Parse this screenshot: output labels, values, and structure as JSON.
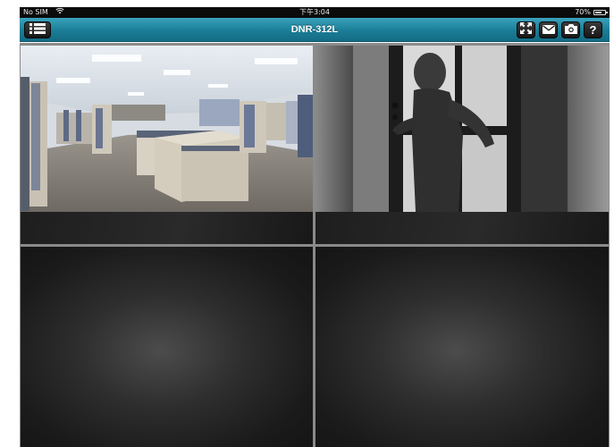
{
  "status_bar": {
    "carrier": "No SIM",
    "wifi_icon": "wifi-icon",
    "time": "下午3:04",
    "battery_percent": "70%",
    "battery_level": 0.7
  },
  "nav_bar": {
    "title": "DNR-312L",
    "background_color": "#1f8aa6",
    "buttons": {
      "menu_icon": "list-menu-icon",
      "fullscreen_icon": "fullscreen-icon",
      "mail_icon": "mail-icon",
      "snapshot_icon": "camera-icon",
      "help_label": "?"
    }
  },
  "camera_grid": {
    "layout": "2x2",
    "feeds": [
      {
        "name": "camera-1",
        "content": "office cubicles"
      },
      {
        "name": "camera-2",
        "content": "figure behind frosted glass door"
      },
      {
        "name": "camera-3",
        "content": "no signal"
      },
      {
        "name": "camera-4",
        "content": "no signal"
      }
    ]
  }
}
